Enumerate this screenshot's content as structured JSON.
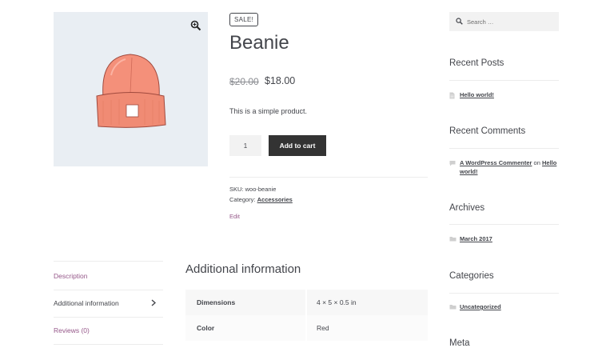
{
  "product": {
    "sale_badge": "SALE!",
    "title": "Beanie",
    "price_old": "$20.00",
    "price_new": "$18.00",
    "short_description": "This is a simple product.",
    "quantity": "1",
    "add_to_cart_label": "Add to cart",
    "sku_label": "SKU:",
    "sku_value": "woo-beanie",
    "category_label": "Category:",
    "category_value": "Accessories",
    "edit_label": "Edit"
  },
  "tabs": [
    {
      "label": "Description"
    },
    {
      "label": "Additional information",
      "active": true
    },
    {
      "label": "Reviews (0)"
    }
  ],
  "additional_info": {
    "heading": "Additional information",
    "rows": [
      {
        "label": "Dimensions",
        "value": "4 × 5 × 0.5 in"
      },
      {
        "label": "Color",
        "value": "Red"
      }
    ]
  },
  "sidebar": {
    "search_placeholder": "Search …",
    "recent_posts": {
      "title": "Recent Posts",
      "items": [
        "Hello world!"
      ]
    },
    "recent_comments": {
      "title": "Recent Comments",
      "author": "A WordPress Commenter",
      "on": "on",
      "post_line1": "Hello",
      "post_line2": "world!"
    },
    "archives": {
      "title": "Archives",
      "items": [
        "March 2017"
      ]
    },
    "categories": {
      "title": "Categories",
      "items": [
        "Uncategorized"
      ]
    },
    "meta": {
      "title": "Meta"
    }
  },
  "colors": {
    "accent": "#96588a",
    "button": "#333333",
    "image_bg": "#e9eef3",
    "beanie": "#f08b74"
  },
  "icons": [
    "zoom-icon",
    "chevron-right-icon",
    "search-icon",
    "document-icon",
    "comment-icon",
    "folder-icon"
  ]
}
